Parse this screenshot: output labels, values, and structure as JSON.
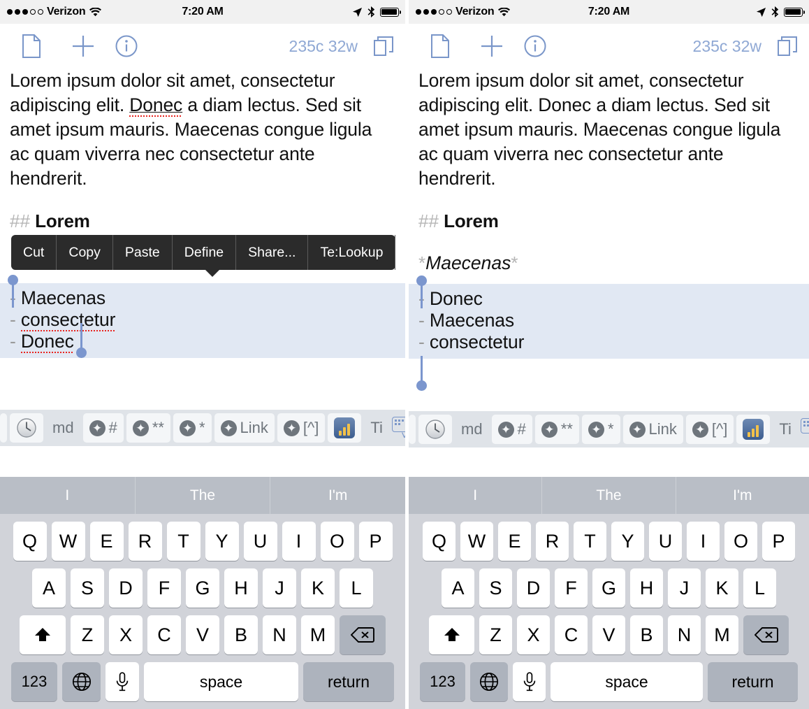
{
  "statusbar": {
    "carrier": "Verizon",
    "time": "7:20 AM",
    "signal_dots_filled": 3,
    "signal_dots_total": 5,
    "wifi_icon": "wifi-icon",
    "location_icon": "location-arrow-icon",
    "bluetooth_icon": "bluetooth-icon",
    "battery_icon": "battery-full-icon"
  },
  "navbar": {
    "document_icon": "document-icon",
    "new_icon": "plus-icon",
    "info_icon": "info-circle-icon",
    "counts": "235c 32w",
    "pages_icon": "copy-pages-icon"
  },
  "document": {
    "paragraph_part1": "Lorem ipsum dolor sit amet, consectetur adipiscing elit.  ",
    "paragraph_misspelled": "Donec",
    "paragraph_part2": " a diam lectus.  Sed sit amet ipsum mauris.  Maecenas congue ligula ac quam viverra nec consectetur ante hendrerit.",
    "heading_marker": "##",
    "heading_text": "Lorem",
    "emphasis_marker_open": "*",
    "emphasis_text": "Maecenas",
    "emphasis_marker_close": "*"
  },
  "left_screen": {
    "menu": {
      "items": [
        "Cut",
        "Copy",
        "Paste",
        "Define",
        "Share...",
        "Te:Lookup"
      ]
    },
    "list_items": [
      {
        "bullet": "-",
        "text": "Maecenas",
        "misspelled": false
      },
      {
        "bullet": "-",
        "text": "consectetur",
        "misspelled": true
      },
      {
        "bullet": "-",
        "text": "Donec",
        "misspelled": true
      }
    ]
  },
  "right_screen": {
    "list_items": [
      {
        "bullet": "-",
        "text": "Donec"
      },
      {
        "bullet": "-",
        "text": "Maecenas"
      },
      {
        "bullet": "-",
        "text": "consectetur"
      }
    ]
  },
  "accessory_toolbar": {
    "clock_icon": "clock-icon",
    "md_label": "md",
    "buttons": [
      {
        "icon": "star-circle-icon",
        "label": "#"
      },
      {
        "icon": "star-circle-icon",
        "label": "**"
      },
      {
        "icon": "star-circle-icon",
        "label": "*"
      },
      {
        "icon": "star-circle-icon",
        "label": "Link"
      },
      {
        "icon": "star-circle-icon",
        "label": "[^]"
      }
    ],
    "chart_icon": "bar-chart-icon",
    "truncated_label": "Ti",
    "dismiss_icon": "hide-keyboard-icon"
  },
  "keyboard": {
    "suggestions": [
      "I",
      "The",
      "I'm"
    ],
    "row1": [
      "Q",
      "W",
      "E",
      "R",
      "T",
      "Y",
      "U",
      "I",
      "O",
      "P"
    ],
    "row2": [
      "A",
      "S",
      "D",
      "F",
      "G",
      "H",
      "J",
      "K",
      "L"
    ],
    "row3": [
      "Z",
      "X",
      "C",
      "V",
      "B",
      "N",
      "M"
    ],
    "shift_icon": "shift-up-arrow-icon",
    "backspace_icon": "backspace-icon",
    "numbers_label": "123",
    "globe_icon": "globe-icon",
    "mic_icon": "microphone-icon",
    "space_label": "space",
    "return_label": "return"
  },
  "colors": {
    "accent_blue": "#7a96c9",
    "selection_highlight": "#e1e8f3",
    "menu_background": "#2b2b2b",
    "keyboard_background": "#d1d3d9",
    "suggestion_background": "#b9bec6",
    "spellcheck_red": "#e8241f",
    "toolbar_background": "#dfe3e8"
  }
}
